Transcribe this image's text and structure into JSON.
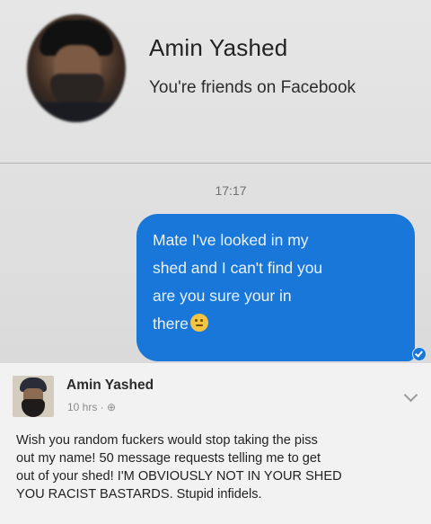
{
  "profile": {
    "name": "Amin Yashed",
    "relationship": "You're friends on Facebook"
  },
  "conversation": {
    "timestamp": "17:17",
    "message": {
      "lines": [
        "Mate I've looked in my",
        "shed and I can't find you",
        "are you sure your in",
        "there"
      ],
      "emoji": "thinking-face-icon"
    }
  },
  "post": {
    "author": "Amin Yashed",
    "meta": "10 hrs ·",
    "lines": [
      "Wish you random fuckers would stop taking the piss",
      "out my name! 50 message requests telling me to get",
      "out of your shed! I'M OBVIOUSLY NOT IN YOUR SHED",
      "YOU RACIST BASTARDS. Stupid infidels."
    ]
  },
  "colors": {
    "bubble": "#1877d9",
    "background": "#dcdcdc"
  }
}
